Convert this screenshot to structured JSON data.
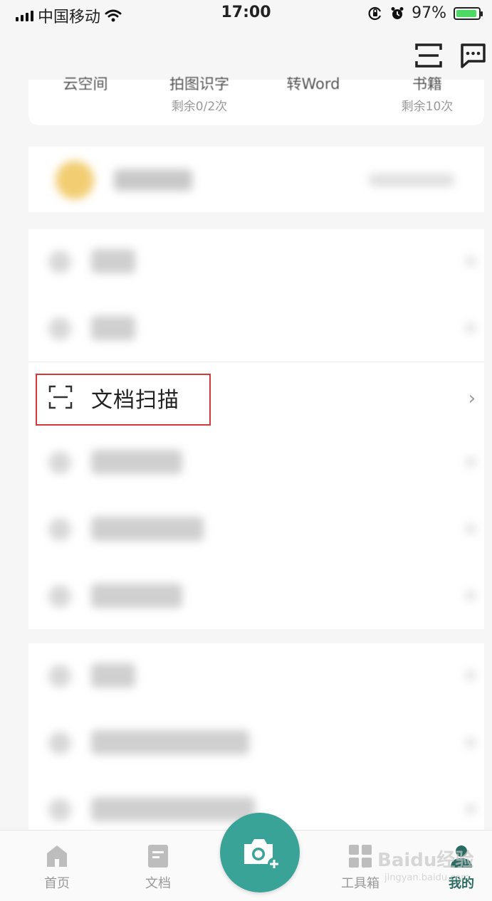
{
  "status_bar": {
    "carrier": "中国移动",
    "time": "17:00",
    "battery_percent": "97%"
  },
  "top_card": {
    "items": [
      {
        "title": "云空间",
        "sub": ""
      },
      {
        "title": "拍图识字",
        "sub": "剩余0/2次"
      },
      {
        "title": "转Word",
        "sub": ""
      },
      {
        "title": "书籍",
        "sub": "剩余10次"
      }
    ]
  },
  "menu": {
    "highlighted_item_label": "文档扫描"
  },
  "tab_bar": {
    "tabs": [
      {
        "label": "首页",
        "icon": "home-icon"
      },
      {
        "label": "文档",
        "icon": "document-icon"
      },
      {
        "label": "工具箱",
        "icon": "grid-icon"
      },
      {
        "label": "我的",
        "icon": "person-icon"
      }
    ],
    "center_button_icon": "camera-plus-icon"
  },
  "colors": {
    "accent": "#3aa397",
    "highlight_border": "#d23a3a",
    "active_tab": "#2a6b62"
  }
}
